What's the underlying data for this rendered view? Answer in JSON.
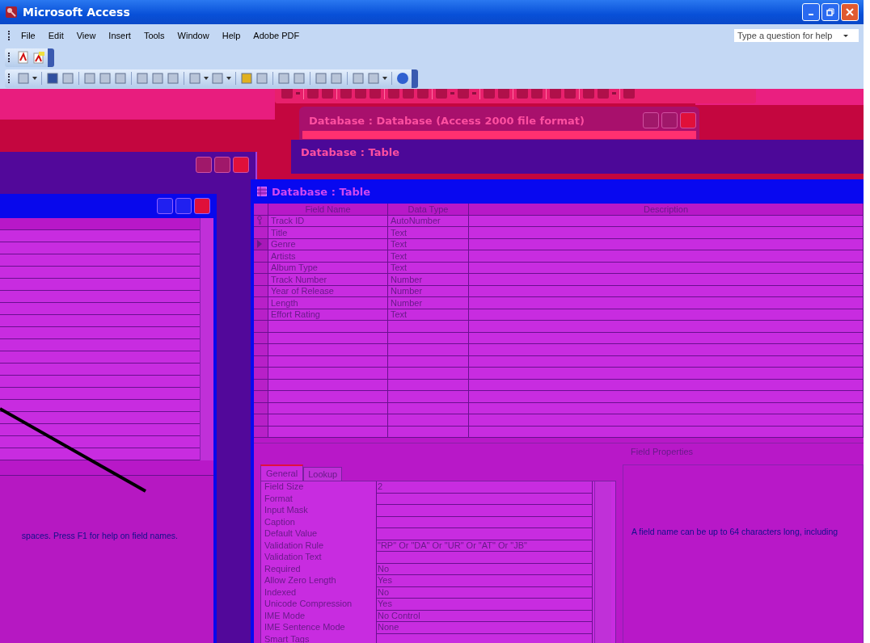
{
  "window": {
    "title": "Microsoft Access"
  },
  "menu": [
    "File",
    "Edit",
    "View",
    "Insert",
    "Tools",
    "Window",
    "Help",
    "Adobe PDF"
  ],
  "help_box": {
    "placeholder": "Type a question for help"
  },
  "ghost_windows": [
    {
      "title": "Database : Database (Access 2000 file format)"
    },
    {
      "title": "Database : Table"
    }
  ],
  "left_window": {
    "help_text": "spaces.  Press F1 for help on field names."
  },
  "table_window": {
    "title": "Database : Table",
    "columns": [
      "Field Name",
      "Data Type",
      "Description"
    ],
    "rows": [
      {
        "field_name": "Track ID",
        "data_type": "AutoNumber",
        "primary_key": true,
        "selected": false
      },
      {
        "field_name": "Title",
        "data_type": "Text",
        "primary_key": false,
        "selected": false
      },
      {
        "field_name": "Genre",
        "data_type": "Text",
        "primary_key": false,
        "selected": true
      },
      {
        "field_name": "Artists",
        "data_type": "Text",
        "primary_key": false,
        "selected": false
      },
      {
        "field_name": "Album Type",
        "data_type": "Text",
        "primary_key": false,
        "selected": false
      },
      {
        "field_name": "Track Number",
        "data_type": "Number",
        "primary_key": false,
        "selected": false
      },
      {
        "field_name": "Year of Release",
        "data_type": "Number",
        "primary_key": false,
        "selected": false
      },
      {
        "field_name": "Length",
        "data_type": "Number",
        "primary_key": false,
        "selected": false
      },
      {
        "field_name": "Effort Rating",
        "data_type": "Text",
        "primary_key": false,
        "selected": false
      }
    ],
    "field_properties_label": "Field Properties",
    "tabs": [
      {
        "label": "General",
        "selected": true
      },
      {
        "label": "Lookup",
        "selected": false
      }
    ],
    "properties": [
      {
        "label": "Field Size",
        "value": "2"
      },
      {
        "label": "Format"
      },
      {
        "label": "Input Mask"
      },
      {
        "label": "Caption"
      },
      {
        "label": "Default Value"
      },
      {
        "label": "Validation Rule",
        "value": "\"RP\" Or \"DA\" Or \"UR\" Or \"AT\" Or \"JB\""
      },
      {
        "label": "Validation Text"
      },
      {
        "label": "Required",
        "value": "No"
      },
      {
        "label": "Allow Zero Length",
        "value": "Yes"
      },
      {
        "label": "Indexed",
        "value": "No"
      },
      {
        "label": "Unicode Compression",
        "value": "Yes"
      },
      {
        "label": "IME Mode",
        "value": "No Control"
      },
      {
        "label": "IME Sentence Mode",
        "value": "None"
      },
      {
        "label": "Smart Tags"
      }
    ],
    "help_text": "A field name can be up to 64 characters long, including"
  }
}
